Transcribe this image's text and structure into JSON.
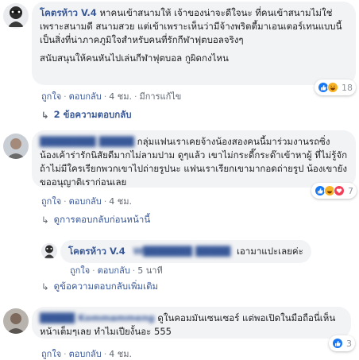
{
  "comments": [
    {
      "author": "โคตรห้าว V.4",
      "text": "หาคนเข้าสนามให้ เจ้าของน่าจะดีใจนะ ที่คนเข้าสนามไม่ใช่เพราะสนามดี สนามสวย แต่เข้าเพราะเห็นว่ามีจ้างพริตตี้มาเอนเตอร์เทนแบบนี้ เป็นสิ่งที่น่าภาคภูมิใจสำหรับคนที่รักกีฬาฟุตบอลจริงๆ",
      "text2": "สนับสนุนให้คนหันไปเล่นกีฬาฟุตบอล กูผิดกงไหน",
      "like": "ถูกใจ",
      "reply": "ตอบกลับ",
      "time": "4 ชม.",
      "edited": "มีการแก้ไข",
      "reaction_count": "18",
      "reply_summary": "2 ข้อความตอบกลับ"
    },
    {
      "author": "████████ █████",
      "text": "กลุ่มแฟนเราเคยจ้างน้องสองคนนี้มาร่วมงานรถซิ่ง น้องเค้าร่ารักนิสัยดีมากไม่ลามปาม ดูๆแล้ว เขาไม่กระดี๊กระด๊าเข้าหาผู้ ที่ไม่รู้จัก ถ้าไม่มีใครเรียกพวกเขาไปถ่ายรูปนะ แฟนเราเรียกเขามากอดถ่ายรูป น้องเขายังขออนุญาติเราก่อนเลย",
      "like": "ถูกใจ",
      "reply": "ตอบกลับ",
      "time": "4 ชม.",
      "reaction_count": "7",
      "prev_replies": "ดูการตอบกลับก่อนหน้านี้"
    },
    {
      "author": "โคตรห้าว V.4",
      "mention": "W███████ █████",
      "text": "เอามาแปะเลยค่ะ",
      "like": "ถูกใจ",
      "reply": "ตอบกลับ",
      "time": "5 นาที",
      "more_replies": "ดูข้อความตอบกลับเพิ่มเติม"
    },
    {
      "author": "█████ Kommammeng",
      "text": "ดูในคอมมันเซนเซอร์ แต่พอเปิดในมือถือนี่เห็นหน้าเต็มๆเลย ทำไมเปียงั้นอะ 555",
      "like": "ถูกใจ",
      "reply": "ตอบกลับ",
      "time": "4 ชม.",
      "reaction_count": "3"
    }
  ],
  "colors": {
    "link": "#385898",
    "bubble": "#f2f3f5",
    "like": "#1877f2",
    "haha": "#f7b125",
    "love": "#f33e58"
  },
  "icons": [
    "like-icon",
    "haha-icon",
    "love-icon",
    "reply-arrow-icon"
  ]
}
